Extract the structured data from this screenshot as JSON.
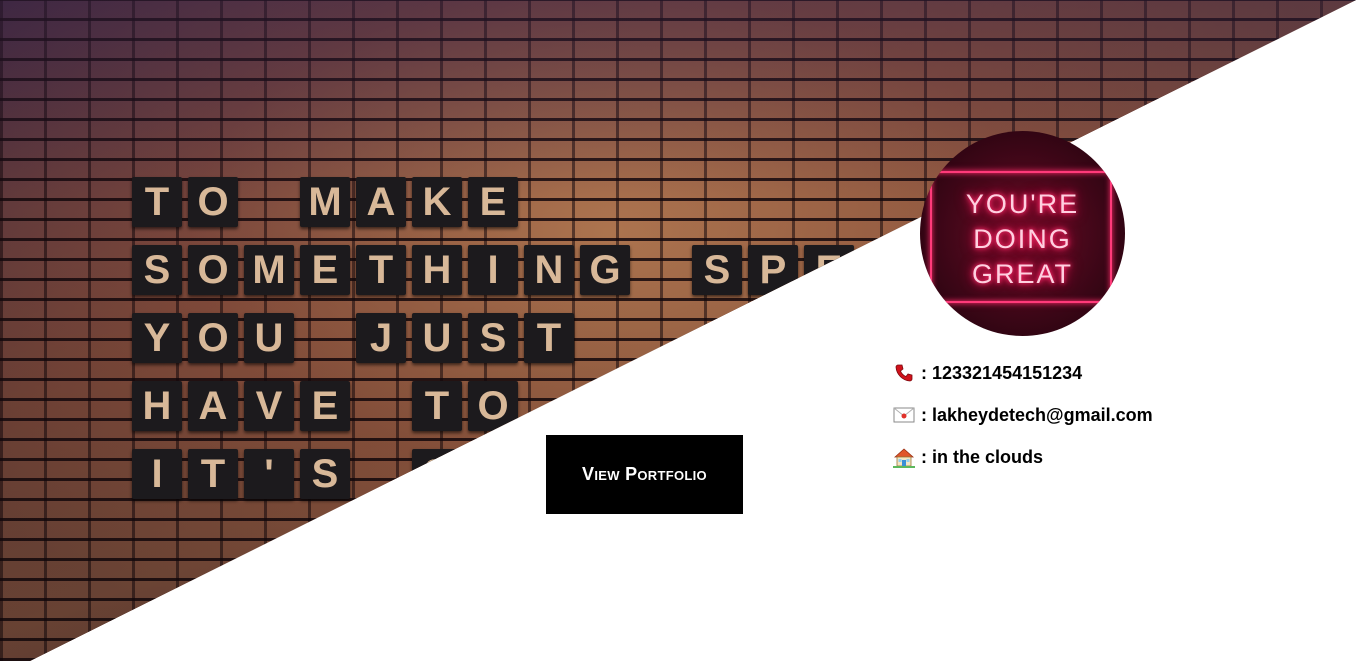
{
  "hero": {
    "quote_lines": [
      "TO MAKE",
      "SOMETHING SPE",
      "YOU JUST",
      "HAVE TO",
      "IT'S S"
    ]
  },
  "cta": {
    "label": "View Portfolio"
  },
  "avatar": {
    "neon_lines": [
      "YOU'RE",
      "DOING",
      "GREAT"
    ]
  },
  "contact": {
    "phone": {
      "icon": "phone-icon",
      "text": ": 123321454151234"
    },
    "email": {
      "icon": "mail-icon",
      "text": ": lakheydetech@gmail.com"
    },
    "address": {
      "icon": "house-icon",
      "text": ": in the clouds"
    }
  },
  "colors": {
    "cta_background": "#000000",
    "cta_text": "#ffffff",
    "neon": "#ff2a6a",
    "tile_letters": "#d8b898"
  }
}
